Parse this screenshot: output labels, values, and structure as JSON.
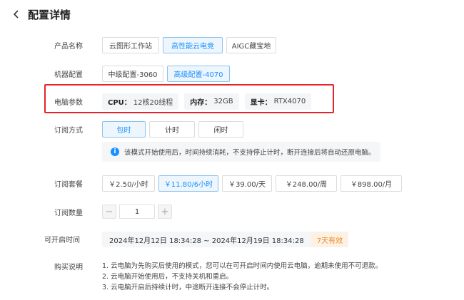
{
  "header": {
    "title": "配置详情"
  },
  "product": {
    "label": "产品名称",
    "options": [
      "云图形工作站",
      "高性能云电竞",
      "AIGC藏宝地"
    ],
    "selected": 1
  },
  "machine": {
    "label": "机器配置",
    "options": [
      "中级配置-3060",
      "高级配置-4070"
    ],
    "selected": 1
  },
  "params": {
    "label": "电脑参数",
    "items": [
      {
        "key": "CPU：",
        "value": "12核20线程"
      },
      {
        "key": "内存：",
        "value": "32GB"
      },
      {
        "key": "显卡：",
        "value": "RTX4070"
      }
    ]
  },
  "subscribe_mode": {
    "label": "订阅方式",
    "options": [
      "包时",
      "计时",
      "闲时"
    ],
    "selected": 0,
    "notice": "该模式开始使用后，时间持续消耗，不支持停止计时，断开连接后将自动还原电脑。"
  },
  "package": {
    "label": "订阅套餐",
    "options": [
      "￥2.50/小时",
      "￥11.80/6小时",
      "￥39.00/天",
      "￥248.00/周",
      "￥898.00/月"
    ],
    "selected": 1
  },
  "quantity": {
    "label": "订阅数量",
    "value": "1",
    "minus": "−",
    "plus": "+"
  },
  "open_time": {
    "label": "可开启时间",
    "range": "2024年12月12日 18:34:28 ~ 2024年12月19日 18:34:28",
    "badge": "7天有效"
  },
  "purchase_notes": {
    "label": "购买说明",
    "lines": [
      "1. 云电脑为先购买后使用的模式，您可以在可开启时间内使用云电脑，逾期未使用不可退款。",
      "2. 云电脑开始使用后，不支持关机和重启。",
      "3. 云电脑开启后持续计时，中途断开连接不会停止计时。"
    ]
  },
  "colors": {
    "accent": "#1890ff",
    "highlight_border": "#e6242a",
    "valid_badge": "#f08a24"
  }
}
